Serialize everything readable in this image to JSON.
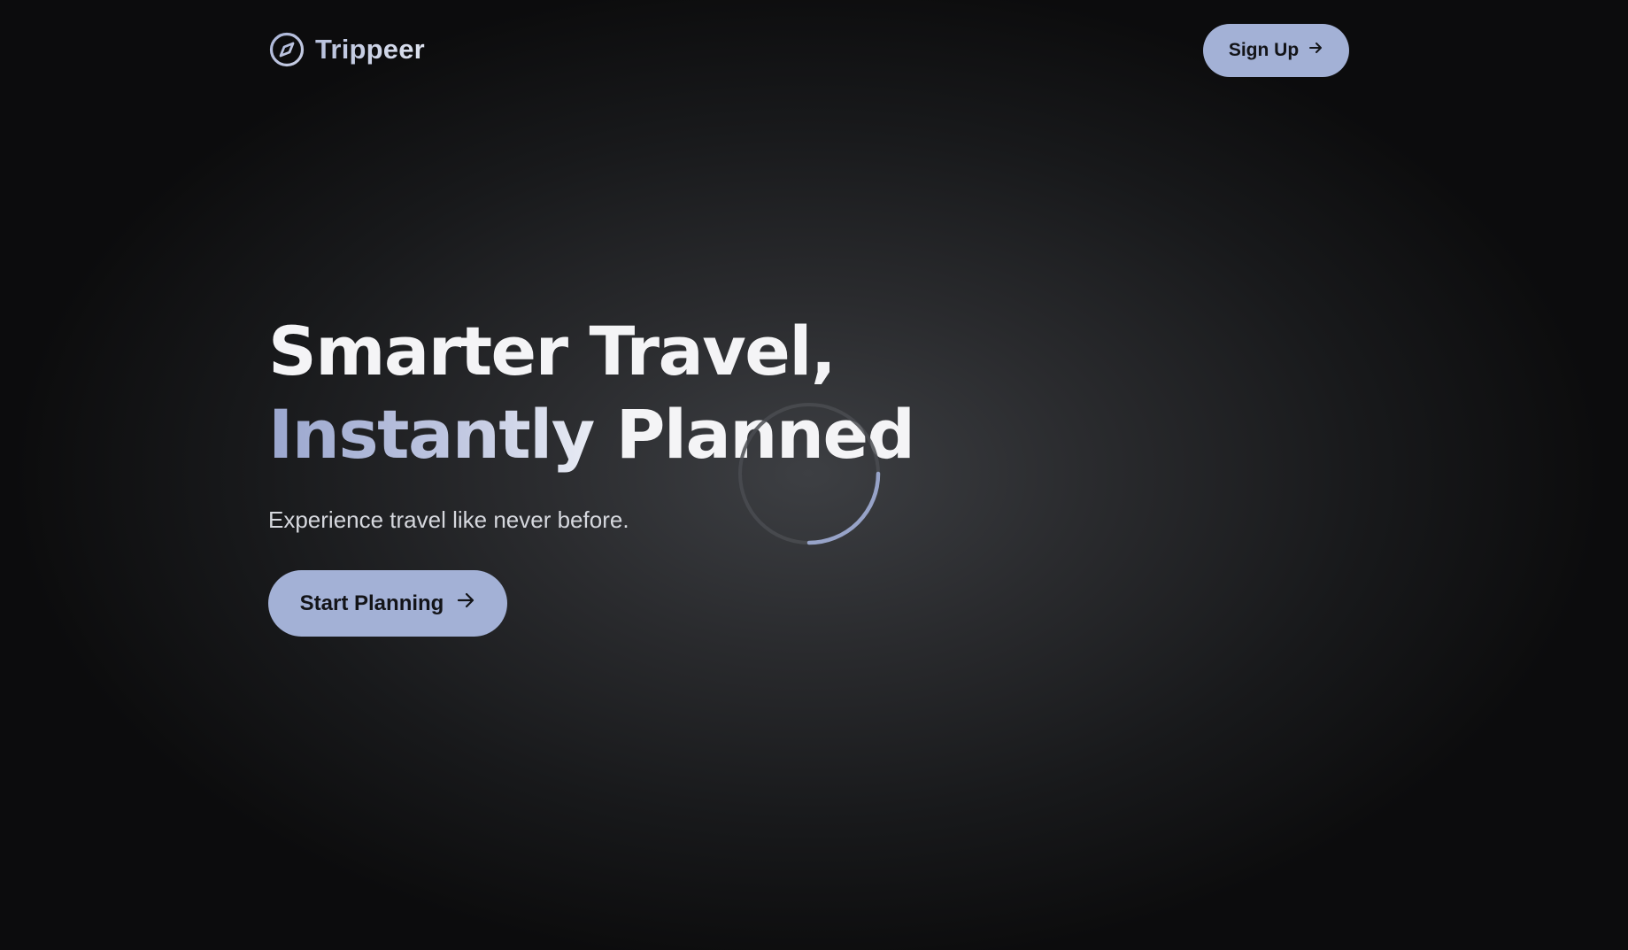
{
  "header": {
    "brand_name": "Trippeer",
    "brand_icon": "compass-icon",
    "signup_label": "Sign Up",
    "signup_icon": "arrow-right-icon"
  },
  "hero": {
    "title_line1": "Smarter Travel,",
    "title_line2_accent": "Instantly",
    "title_line2_rest": " Planned",
    "subtitle": "Experience travel like never before.",
    "cta_label": "Start Planning",
    "cta_icon": "arrow-right-icon"
  },
  "loader": {
    "icon": "loading-spinner-icon"
  },
  "colors": {
    "accent": "#a3b1d6",
    "background": "#0c0c0d",
    "text": "#f4f4f6"
  }
}
